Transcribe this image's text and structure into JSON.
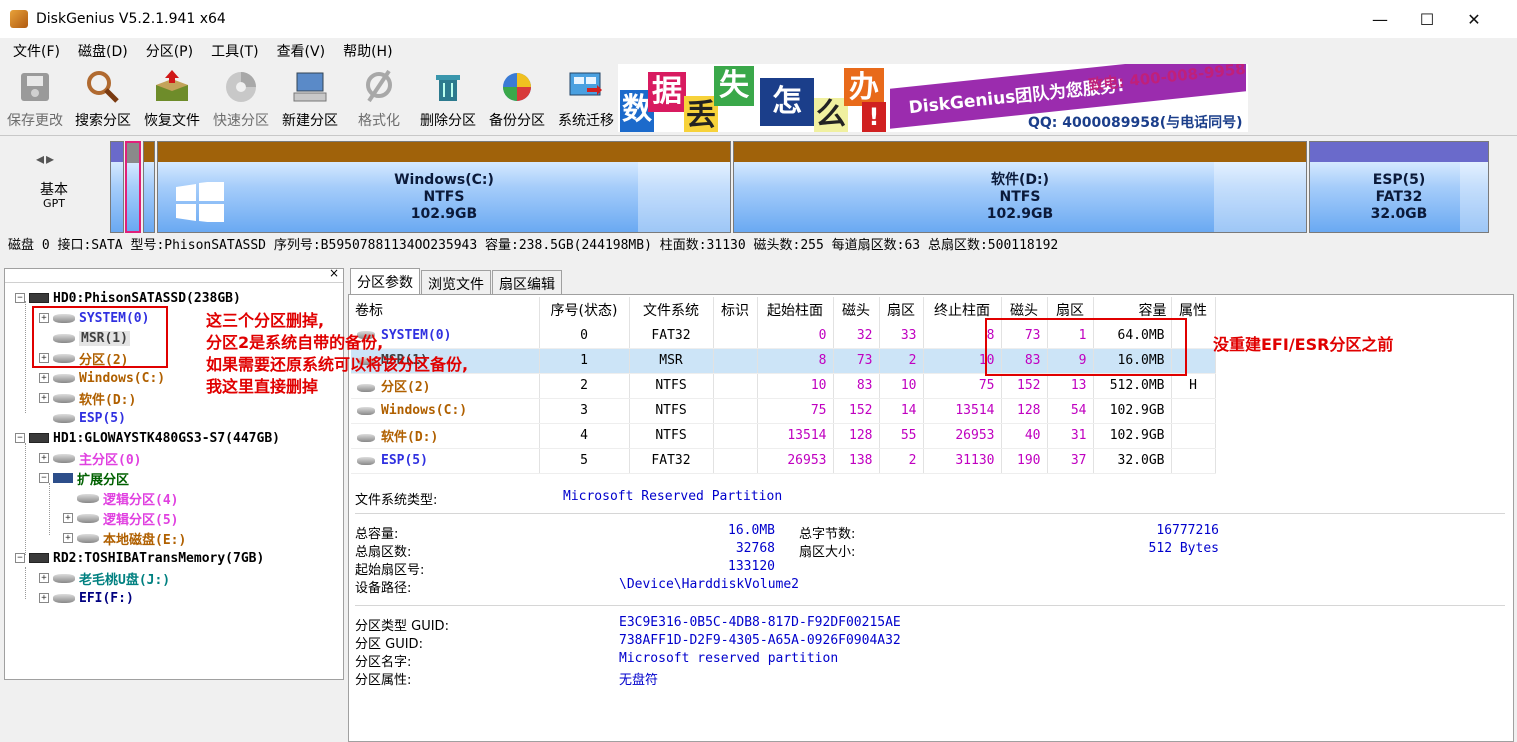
{
  "window": {
    "title": "DiskGenius V5.2.1.941 x64",
    "minimize": "—",
    "maximize": "☐",
    "close": "✕"
  },
  "menu": [
    "文件(F)",
    "磁盘(D)",
    "分区(P)",
    "工具(T)",
    "查看(V)",
    "帮助(H)"
  ],
  "toolbar": [
    "保存更改",
    "搜索分区",
    "恢复文件",
    "快速分区",
    "新建分区",
    "格式化",
    "删除分区",
    "备份分区",
    "系统迁移"
  ],
  "banner": {
    "chars": [
      "数",
      "据",
      "丢",
      "失",
      "怎",
      "么",
      "办",
      "!"
    ],
    "brand": "DiskGenius团队为您服务!",
    "phone": "致电: 400-008-9958",
    "qq": "QQ: 4000089958(与电话同号)"
  },
  "diskbar": {
    "nav": "◂▸",
    "type": "基本",
    "style": "GPT",
    "partitions": [
      {
        "name": "Windows(C:)",
        "fs": "NTFS",
        "size": "102.9GB"
      },
      {
        "name": "软件(D:)",
        "fs": "NTFS",
        "size": "102.9GB"
      },
      {
        "name": "ESP(5)",
        "fs": "FAT32",
        "size": "32.0GB"
      }
    ]
  },
  "diskinfo": "磁盘 0 接口:SATA  型号:PhisonSATASSD  序列号:B59507881134OO235943  容量:238.5GB(244198MB)  柱面数:31130  磁头数:255  每道扇区数:63  总扇区数:500118192",
  "tree": {
    "close": "×",
    "nodes": [
      {
        "label": "HD0:PhisonSATASSD(238GB)",
        "color": "#000000"
      },
      {
        "label": "SYSTEM(0)",
        "color": "#3030e0"
      },
      {
        "label": "MSR(1)",
        "color": "#404040"
      },
      {
        "label": "分区(2)",
        "color": "#b06000"
      },
      {
        "label": "Windows(C:)",
        "color": "#b06000"
      },
      {
        "label": "软件(D:)",
        "color": "#b06000"
      },
      {
        "label": "ESP(5)",
        "color": "#3030e0"
      },
      {
        "label": "HD1:GLOWAYSTK480GS3-S7(447GB)",
        "color": "#000000"
      },
      {
        "label": "主分区(0)",
        "color": "#e040e0"
      },
      {
        "label": "扩展分区",
        "color": "#006000"
      },
      {
        "label": "逻辑分区(4)",
        "color": "#e040e0"
      },
      {
        "label": "逻辑分区(5)",
        "color": "#e040e0"
      },
      {
        "label": "本地磁盘(E:)",
        "color": "#b06000"
      },
      {
        "label": "RD2:TOSHIBATransMemory(7GB)",
        "color": "#000000"
      },
      {
        "label": "老毛桃U盘(J:)",
        "color": "#008080"
      },
      {
        "label": "EFI(F:)",
        "color": "#000080"
      }
    ]
  },
  "tabs": [
    "分区参数",
    "浏览文件",
    "扇区编辑"
  ],
  "table": {
    "headers": [
      "卷标",
      "序号(状态)",
      "文件系统",
      "标识",
      "起始柱面",
      "磁头",
      "扇区",
      "终止柱面",
      "磁头",
      "扇区",
      "容量",
      "属性"
    ],
    "rows": [
      {
        "name": "SYSTEM(0)",
        "color": "#3030e0",
        "cells": [
          "0",
          "FAT32",
          "",
          "0",
          "32",
          "33",
          "8",
          "73",
          "1",
          "64.0MB",
          ""
        ]
      },
      {
        "name": "MSR(1)",
        "color": "#404040",
        "cells": [
          "1",
          "MSR",
          "",
          "8",
          "73",
          "2",
          "10",
          "83",
          "9",
          "16.0MB",
          ""
        ]
      },
      {
        "name": "分区(2)",
        "color": "#b06000",
        "cells": [
          "2",
          "NTFS",
          "",
          "10",
          "83",
          "10",
          "75",
          "152",
          "13",
          "512.0MB",
          "H"
        ]
      },
      {
        "name": "Windows(C:)",
        "color": "#b06000",
        "cells": [
          "3",
          "NTFS",
          "",
          "75",
          "152",
          "14",
          "13514",
          "128",
          "54",
          "102.9GB",
          ""
        ]
      },
      {
        "name": "软件(D:)",
        "color": "#b06000",
        "cells": [
          "4",
          "NTFS",
          "",
          "13514",
          "128",
          "55",
          "26953",
          "40",
          "31",
          "102.9GB",
          ""
        ]
      },
      {
        "name": "ESP(5)",
        "color": "#3030e0",
        "cells": [
          "5",
          "FAT32",
          "",
          "26953",
          "138",
          "2",
          "31130",
          "190",
          "37",
          "32.0GB",
          ""
        ]
      }
    ]
  },
  "details": {
    "fs_type_label": "文件系统类型:",
    "fs_type": "Microsoft Reserved Partition",
    "total_cap_label": "总容量:",
    "total_cap": "16.0MB",
    "total_bytes_label": "总字节数:",
    "total_bytes": "16777216",
    "total_sectors_label": "总扇区数:",
    "total_sectors": "32768",
    "sector_size_label": "扇区大小:",
    "sector_size": "512 Bytes",
    "start_sector_label": "起始扇区号:",
    "start_sector": "133120",
    "device_path_label": "设备路径:",
    "device_path": "\\Device\\HarddiskVolume2",
    "type_guid_label": "分区类型 GUID:",
    "type_guid": "E3C9E316-0B5C-4DB8-817D-F92DF00215AE",
    "part_guid_label": "分区 GUID:",
    "part_guid": "738AFF1D-D2F9-4305-A65A-0926F0904A32",
    "part_name_label": "分区名字:",
    "part_name": "Microsoft reserved partition",
    "part_attr_label": "分区属性:",
    "part_attr": "无盘符"
  },
  "annotations": {
    "left": [
      "这三个分区删掉,",
      "分区2是系统自带的备份,",
      "如果需要还原系统可以将该分区备份,",
      "我这里直接删掉"
    ],
    "right": "没重建EFI/ESR分区之前"
  },
  "colors": {
    "accent_red": "#e00000",
    "partition_blue": "#6aa9f2",
    "partition_top": "#a0620a",
    "selected_row": "#cce4f7"
  }
}
